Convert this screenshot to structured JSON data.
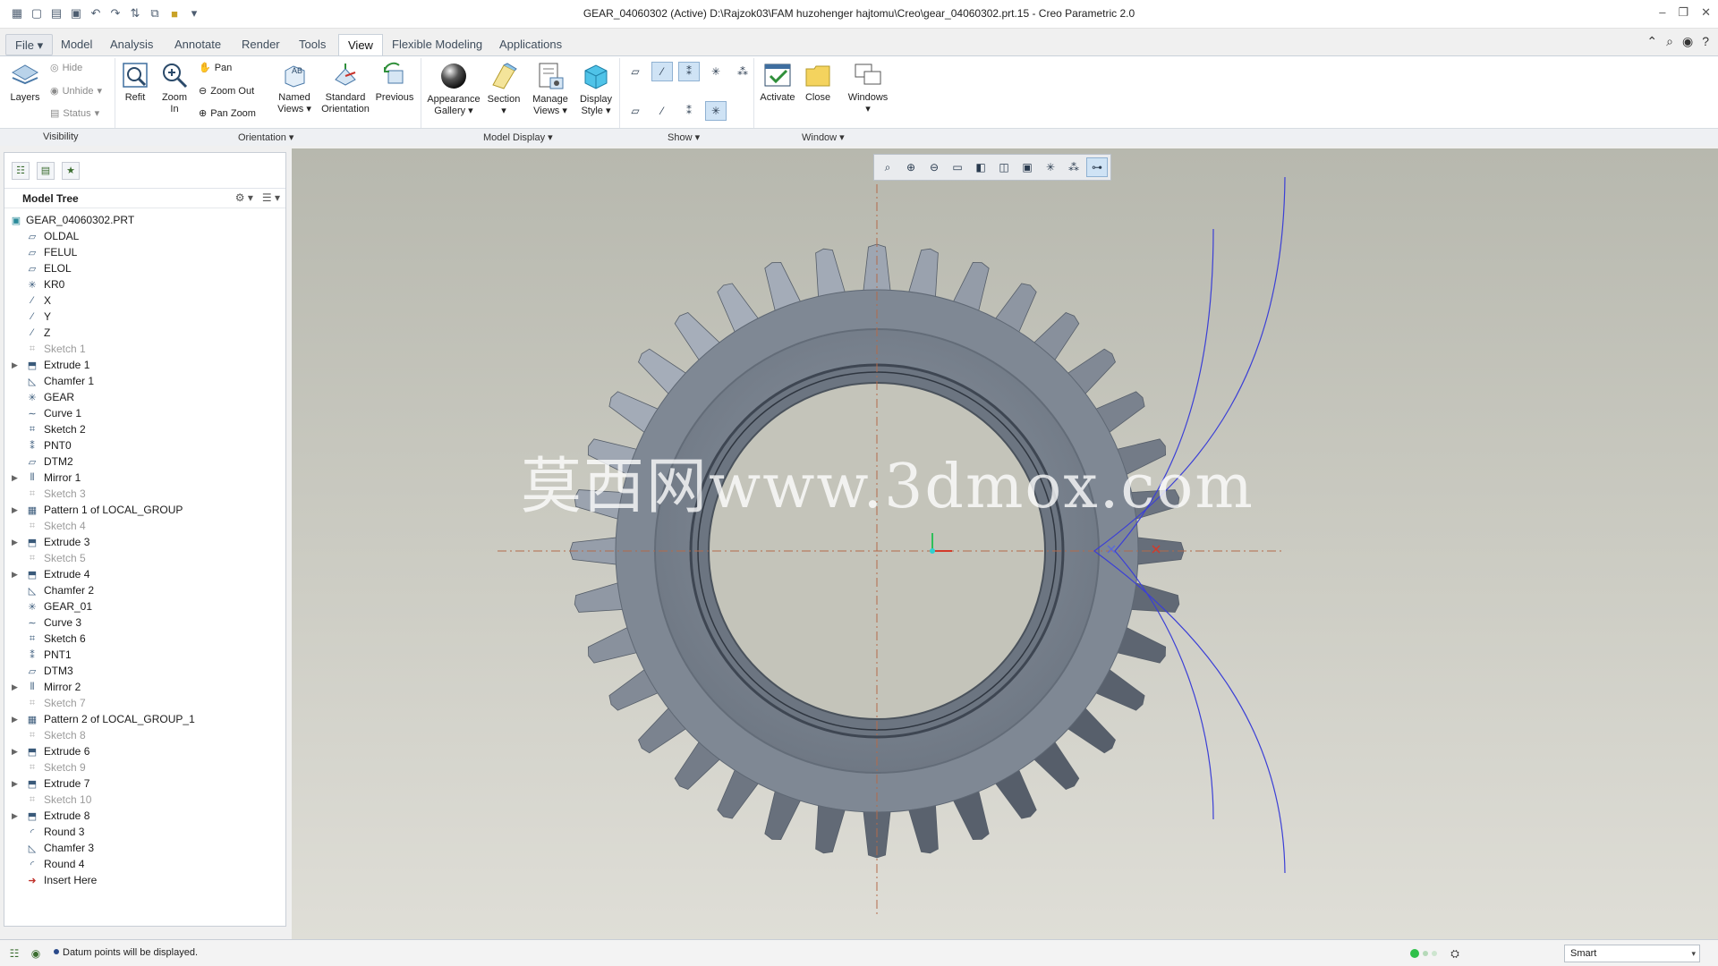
{
  "window": {
    "title": "GEAR_04060302 (Active) D:\\Rajzok03\\FAM huzohenger hajtomu\\Creo\\gear_04060302.prt.15 - Creo Parametric 2.0"
  },
  "tabs": [
    "File",
    "Model",
    "Analysis",
    "Annotate",
    "Render",
    "Tools",
    "View",
    "Flexible Modeling",
    "Applications"
  ],
  "active_tab": "View",
  "ribbon": {
    "layers": "Layers",
    "hide": "Hide",
    "unhide": "Unhide",
    "status": "Status",
    "refit": "Refit",
    "zoom_in": "Zoom In",
    "pan": "Pan",
    "zoom_out": "Zoom Out",
    "pan_zoom": "Pan Zoom",
    "named_views": [
      "Named",
      "Views"
    ],
    "standard_orientation": [
      "Standard",
      "Orientation"
    ],
    "previous": "Previous",
    "appearance_gallery": [
      "Appearance",
      "Gallery"
    ],
    "section": "Section",
    "manage_views": [
      "Manage",
      "Views"
    ],
    "display_style": [
      "Display",
      "Style"
    ],
    "activate": "Activate",
    "close": "Close",
    "windows": "Windows"
  },
  "groups": [
    "Visibility",
    "Orientation",
    "Model Display",
    "Show",
    "Window"
  ],
  "model_tree": {
    "header": "Model Tree",
    "root": "GEAR_04060302.PRT",
    "items": [
      {
        "label": "OLDAL",
        "icon": "datum-plane-icon",
        "dim": false,
        "expandable": false
      },
      {
        "label": "FELUL",
        "icon": "datum-plane-icon",
        "dim": false,
        "expandable": false
      },
      {
        "label": "ELOL",
        "icon": "datum-plane-icon",
        "dim": false,
        "expandable": false
      },
      {
        "label": "KR0",
        "icon": "coordinate-system-icon",
        "dim": false,
        "expandable": false
      },
      {
        "label": "X",
        "icon": "datum-axis-icon",
        "dim": false,
        "expandable": false
      },
      {
        "label": "Y",
        "icon": "datum-axis-icon",
        "dim": false,
        "expandable": false
      },
      {
        "label": "Z",
        "icon": "datum-axis-icon",
        "dim": false,
        "expandable": false
      },
      {
        "label": "Sketch 1",
        "icon": "sketch-icon",
        "dim": true,
        "expandable": false
      },
      {
        "label": "Extrude 1",
        "icon": "extrude-icon",
        "dim": false,
        "expandable": true
      },
      {
        "label": "Chamfer 1",
        "icon": "chamfer-icon",
        "dim": false,
        "expandable": false
      },
      {
        "label": "GEAR",
        "icon": "coordinate-system-icon",
        "dim": false,
        "expandable": false
      },
      {
        "label": "Curve 1",
        "icon": "curve-icon",
        "dim": false,
        "expandable": false
      },
      {
        "label": "Sketch 2",
        "icon": "sketch-icon",
        "dim": false,
        "expandable": false
      },
      {
        "label": "PNT0",
        "icon": "datum-point-icon",
        "dim": false,
        "expandable": false
      },
      {
        "label": "DTM2",
        "icon": "datum-plane-icon",
        "dim": false,
        "expandable": false
      },
      {
        "label": "Mirror 1",
        "icon": "mirror-icon",
        "dim": false,
        "expandable": true
      },
      {
        "label": "Sketch 3",
        "icon": "sketch-icon",
        "dim": true,
        "expandable": false
      },
      {
        "label": "Pattern 1 of LOCAL_GROUP",
        "icon": "pattern-icon",
        "dim": false,
        "expandable": true
      },
      {
        "label": "Sketch 4",
        "icon": "sketch-icon",
        "dim": true,
        "expandable": false
      },
      {
        "label": "Extrude 3",
        "icon": "extrude-icon",
        "dim": false,
        "expandable": true
      },
      {
        "label": "Sketch 5",
        "icon": "sketch-icon",
        "dim": true,
        "expandable": false
      },
      {
        "label": "Extrude 4",
        "icon": "extrude-icon",
        "dim": false,
        "expandable": true
      },
      {
        "label": "Chamfer 2",
        "icon": "chamfer-icon",
        "dim": false,
        "expandable": false
      },
      {
        "label": "GEAR_01",
        "icon": "coordinate-system-icon",
        "dim": false,
        "expandable": false
      },
      {
        "label": "Curve 3",
        "icon": "curve-icon",
        "dim": false,
        "expandable": false
      },
      {
        "label": "Sketch 6",
        "icon": "sketch-icon",
        "dim": false,
        "expandable": false
      },
      {
        "label": "PNT1",
        "icon": "datum-point-icon",
        "dim": false,
        "expandable": false
      },
      {
        "label": "DTM3",
        "icon": "datum-plane-icon",
        "dim": false,
        "expandable": false
      },
      {
        "label": "Mirror 2",
        "icon": "mirror-icon",
        "dim": false,
        "expandable": true
      },
      {
        "label": "Sketch 7",
        "icon": "sketch-icon",
        "dim": true,
        "expandable": false
      },
      {
        "label": "Pattern 2 of LOCAL_GROUP_1",
        "icon": "pattern-icon",
        "dim": false,
        "expandable": true
      },
      {
        "label": "Sketch 8",
        "icon": "sketch-icon",
        "dim": true,
        "expandable": false
      },
      {
        "label": "Extrude 6",
        "icon": "extrude-icon",
        "dim": false,
        "expandable": true
      },
      {
        "label": "Sketch 9",
        "icon": "sketch-icon",
        "dim": true,
        "expandable": false
      },
      {
        "label": "Extrude 7",
        "icon": "extrude-icon",
        "dim": false,
        "expandable": true
      },
      {
        "label": "Sketch 10",
        "icon": "sketch-icon",
        "dim": true,
        "expandable": false
      },
      {
        "label": "Extrude 8",
        "icon": "extrude-icon",
        "dim": false,
        "expandable": true
      },
      {
        "label": "Round 3",
        "icon": "round-icon",
        "dim": false,
        "expandable": false
      },
      {
        "label": "Chamfer 3",
        "icon": "chamfer-icon",
        "dim": false,
        "expandable": false
      },
      {
        "label": "Round 4",
        "icon": "round-icon",
        "dim": false,
        "expandable": false
      },
      {
        "label": "Insert Here",
        "icon": "insert-here-icon",
        "dim": false,
        "expandable": false
      }
    ]
  },
  "viewport": {
    "watermark": "莫西网www.3dmox.com",
    "background_color": "#c4c4ba",
    "model_color": "#7b8490",
    "gear_teeth": 36,
    "toolbar_icons": [
      "refit-icon",
      "zoom-in-icon",
      "zoom-out-icon",
      "repaint-icon",
      "saved-orientations-icon",
      "display-style-icon",
      "named-views-icon",
      "datum-planes-icon",
      "datum-axes-icon",
      "datum-points-icon"
    ]
  },
  "statusbar": {
    "message": "Datum points will be displayed.",
    "filter": "Smart"
  }
}
